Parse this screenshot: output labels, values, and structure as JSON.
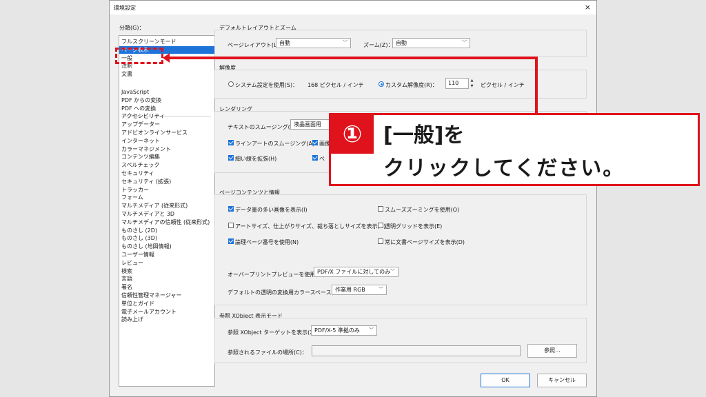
{
  "dialog": {
    "title": "環境設定",
    "close_icon": "×",
    "category_label": "分類(G)：",
    "categories_top": [
      "フルスクリーンモード",
      "ページ表示",
      "一般",
      "注釈",
      "文書"
    ],
    "selected_index": 1,
    "categories_bottom": [
      "JavaScript",
      "PDF からの変換",
      "PDF への変換",
      "アクセシビリティ",
      "アップデーター",
      "アドビオンラインサービス",
      "インターネット",
      "カラーマネジメント",
      "コンテンツ編集",
      "スペルチェック",
      "セキュリティ",
      "セキュリティ (拡張)",
      "トラッカー",
      "フォーム",
      "マルチメディア (従来形式)",
      "マルチメディアと 3D",
      "マルチメディアの信頼性 (従来形式)",
      "ものさし (2D)",
      "ものさし (3D)",
      "ものさし (地図情報)",
      "ユーザー情報",
      "レビュー",
      "検索",
      "言語",
      "署名",
      "信頼性管理マネージャー",
      "単位とガイド",
      "電子メールアカウント",
      "読み上げ"
    ]
  },
  "layout_zoom": {
    "title": "デフォルトレイアウトとズーム",
    "page_layout_label": "ページレイアウト(L)：",
    "page_layout_value": "自動",
    "zoom_label": "ズーム(Z)：",
    "zoom_value": "自動"
  },
  "resolution": {
    "title": "解像度",
    "system_label": "システム設定を使用(S)：",
    "system_value": "168  ピクセル / インチ",
    "custom_label": "カスタム解像度(R)：",
    "custom_value": "110",
    "custom_unit": "ピクセル / インチ"
  },
  "rendering": {
    "title": "レンダリング",
    "smoothing_label": "テキストのスムージング(T)：",
    "smoothing_value": "液晶画面用",
    "line_art_label": "ラインアートのスムージング(A)",
    "image_label": "画像",
    "thin_lines_label": "細い線を拡張(H)",
    "page_label": "ペ"
  },
  "page_content": {
    "title": "ページコンテンツと情報",
    "large_images": "データ量の多い画像を表示(I)",
    "smooth_zoom": "スムーズズーミングを使用(O)",
    "art_trim": "アートサイズ、仕上がりサイズ、裁ち落としサイズを表示(B)",
    "transparency_grid": "透明グリッドを表示(E)",
    "logical_page": "論理ページ番号を使用(N)",
    "doc_page_size": "常に文書ページサイズを表示(D)",
    "overprint_label": "オーバープリントプレビューを使用(W)：",
    "overprint_value": "PDF/X ファイルに対してのみ",
    "blend_label": "デフォルトの透明の変換用カラースペース(C)：",
    "blend_value": "作業用 RGB"
  },
  "xobject": {
    "title": "参照 XObject 表示モード",
    "target_label": "参照 XObject ターゲットを表示(X)：",
    "target_value": "PDF/X-5 準拠のみ",
    "file_label": "参照されるファイルの場所(C)：",
    "file_value": "",
    "browse_label": "参照..."
  },
  "buttons": {
    "ok": "OK",
    "cancel": "キャンセル"
  },
  "callout": {
    "number": "①",
    "line1": "[一般]を",
    "line2": "クリックしてください。"
  },
  "colors": {
    "accent": "#1e73d9",
    "annotation_red": "#e0121b"
  }
}
